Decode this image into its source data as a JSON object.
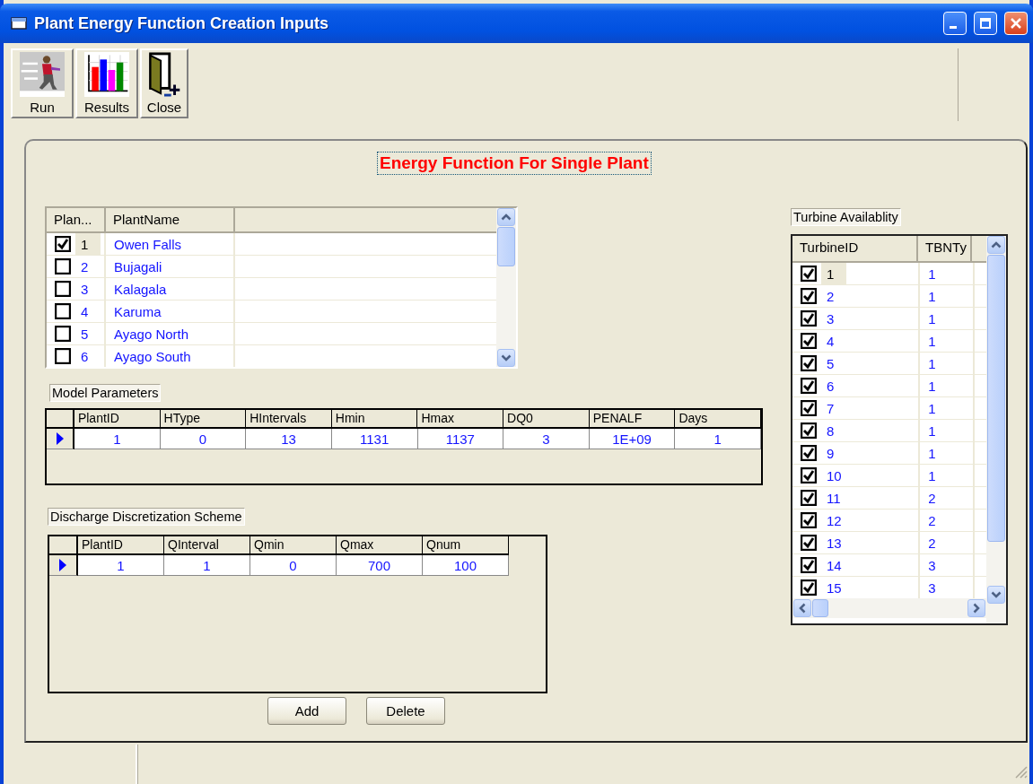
{
  "window": {
    "title": "Plant Energy Function Creation Inputs"
  },
  "toolbar": [
    {
      "label": "Run",
      "kind": "run"
    },
    {
      "label": "Results",
      "kind": "results"
    },
    {
      "label": "Close",
      "kind": "close"
    }
  ],
  "heading": "Energy Function For Single Plant",
  "plants": {
    "columns": [
      "Plan...",
      "PlantName"
    ],
    "rows": [
      {
        "number": "1",
        "name": "Owen Falls",
        "checked": true,
        "selected": true
      },
      {
        "number": "2",
        "name": "Bujagali",
        "checked": false,
        "selected": false
      },
      {
        "number": "3",
        "name": "Kalagala",
        "checked": false,
        "selected": false
      },
      {
        "number": "4",
        "name": "Karuma",
        "checked": false,
        "selected": false
      },
      {
        "number": "5",
        "name": "Ayago North",
        "checked": false,
        "selected": false
      },
      {
        "number": "6",
        "name": "Ayago South",
        "checked": false,
        "selected": false
      }
    ]
  },
  "model_parameters": {
    "label": "Model Parameters",
    "columns": [
      "PlantID",
      "HType",
      "HIntervals",
      "Hmin",
      "Hmax",
      "DQ0",
      "PENALF",
      "Days"
    ],
    "rows": [
      {
        "cells": [
          "1",
          "0",
          "13",
          "1131",
          "1137",
          "3",
          "1E+09",
          "1"
        ],
        "selected": true
      }
    ]
  },
  "discharge": {
    "label": "Discharge Discretization Scheme",
    "columns": [
      "PlantID",
      "QInterval",
      "Qmin",
      "Qmax",
      "Qnum"
    ],
    "rows": [
      {
        "cells": [
          "1",
          "1",
          "0",
          "700",
          "100"
        ],
        "selected": true
      }
    ]
  },
  "buttons": [
    "Add",
    "Delete"
  ],
  "turbines": {
    "label": "Turbine Availablity",
    "columns": [
      "TurbineID",
      "TBNTy"
    ],
    "rows": [
      {
        "number": "1",
        "type": "1",
        "checked": true,
        "selected": true
      },
      {
        "number": "2",
        "type": "1",
        "checked": true,
        "selected": false
      },
      {
        "number": "3",
        "type": "1",
        "checked": true,
        "selected": false
      },
      {
        "number": "4",
        "type": "1",
        "checked": true,
        "selected": false
      },
      {
        "number": "5",
        "type": "1",
        "checked": true,
        "selected": false
      },
      {
        "number": "6",
        "type": "1",
        "checked": true,
        "selected": false
      },
      {
        "number": "7",
        "type": "1",
        "checked": true,
        "selected": false
      },
      {
        "number": "8",
        "type": "1",
        "checked": true,
        "selected": false
      },
      {
        "number": "9",
        "type": "1",
        "checked": true,
        "selected": false
      },
      {
        "number": "10",
        "type": "1",
        "checked": true,
        "selected": false
      },
      {
        "number": "11",
        "type": "2",
        "checked": true,
        "selected": false
      },
      {
        "number": "12",
        "type": "2",
        "checked": true,
        "selected": false
      },
      {
        "number": "13",
        "type": "2",
        "checked": true,
        "selected": false
      },
      {
        "number": "14",
        "type": "3",
        "checked": true,
        "selected": false
      },
      {
        "number": "15",
        "type": "3",
        "checked": true,
        "selected": false
      }
    ]
  }
}
